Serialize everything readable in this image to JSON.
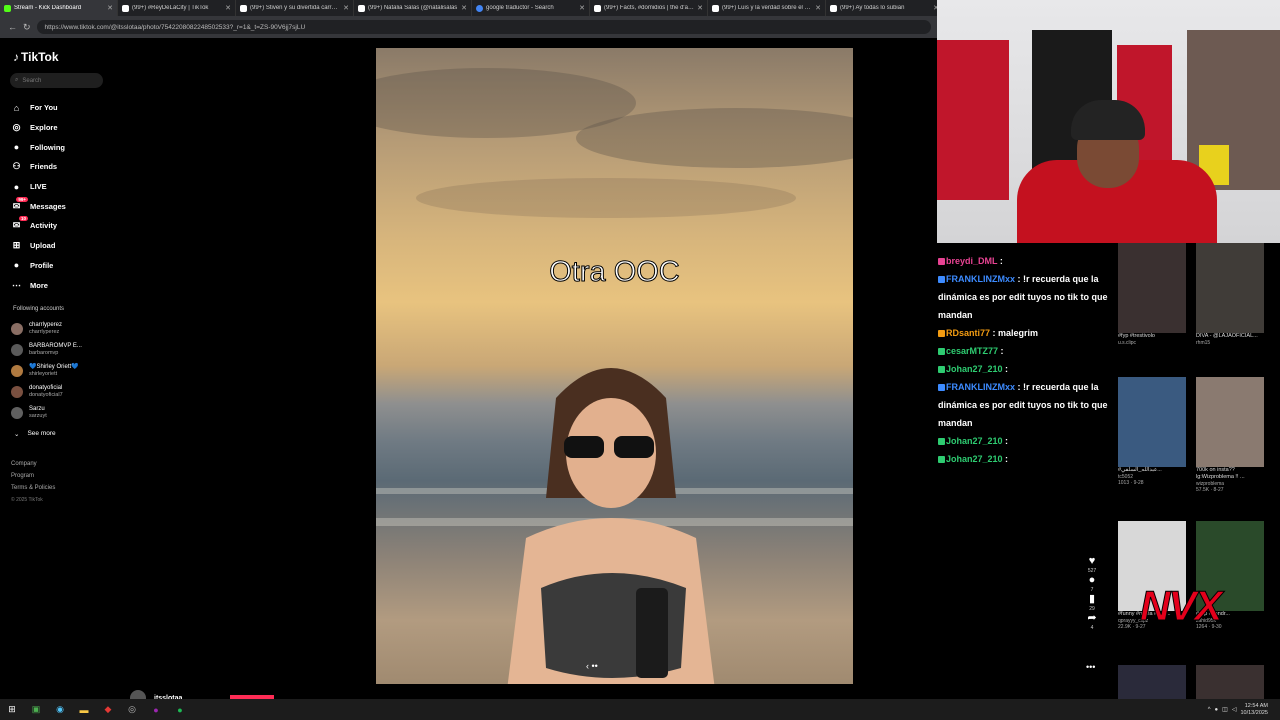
{
  "tabs": [
    {
      "label": "Stream - Kick Dashboard",
      "fav": "kick"
    },
    {
      "label": "(99+) #ReyDeLaCity | TikTok",
      "fav": "tiktok"
    },
    {
      "label": "(99+) Stiven y su divertida carrera",
      "fav": "tiktok"
    },
    {
      "label": "(99+) Natalia Salas (@natalisalas",
      "fav": "tiktok"
    },
    {
      "label": "google traductor - Search",
      "fav": "g"
    },
    {
      "label": "(99+) Facts, #domidios | the d'arm",
      "fav": "tiktok"
    },
    {
      "label": "(99+) Luis y la verdad sobre el car",
      "fav": "tiktok"
    },
    {
      "label": "(99+) Ay todas lo subian",
      "fav": "tiktok"
    }
  ],
  "browser": {
    "url": "https://www.tiktok.com/@itsslotaa/photo/7542208082248502533?_r=1&_t=ZS-90V6jj7sjLU"
  },
  "sidebar": {
    "brand": "TikTok",
    "search_placeholder": "Search",
    "nav": [
      {
        "label": "For You",
        "icon": "home-icon"
      },
      {
        "label": "Explore",
        "icon": "compass-icon"
      },
      {
        "label": "Following",
        "icon": "following-icon"
      },
      {
        "label": "Friends",
        "icon": "friends-icon"
      },
      {
        "label": "LIVE",
        "icon": "live-icon"
      },
      {
        "label": "Messages",
        "icon": "messages-icon",
        "badge": "99+"
      },
      {
        "label": "Activity",
        "icon": "activity-icon",
        "badge": "10"
      },
      {
        "label": "Upload",
        "icon": "upload-icon"
      },
      {
        "label": "Profile",
        "icon": "profile-icon"
      },
      {
        "label": "More",
        "icon": "more-icon"
      }
    ],
    "following_title": "Following accounts",
    "accounts": [
      {
        "name": "charrlyperez",
        "handle": "charrlyperez"
      },
      {
        "name": "BARBAROMVP E...",
        "handle": "barbaromvp"
      },
      {
        "name": "💙Shirley Oriett💙",
        "handle": "shirleyoriett"
      },
      {
        "name": "donatyoficial",
        "handle": "donatyoficial7"
      },
      {
        "name": "Sarzu",
        "handle": "sarzuyt"
      }
    ],
    "see_more": "See more",
    "footer": [
      "Company",
      "Program",
      "Terms & Policies"
    ],
    "copyright": "© 2025 TikTok"
  },
  "post": {
    "caption": "Otra OOC",
    "author": "itsslotaa"
  },
  "chat": [
    {
      "user": "breydi_DML",
      "color": "#e84393",
      "text": ""
    },
    {
      "user": "FRANKLINZMxx",
      "color": "#3d8bff",
      "text": "!r recuerda que la dinámica es por edit tuyos no tik to que mandan"
    },
    {
      "user": "RDsanti77",
      "color": "#f39c12",
      "text": "malegrim"
    },
    {
      "user": "cesarMTZ77",
      "color": "#2ecc71",
      "text": ""
    },
    {
      "user": "Johan27_210",
      "color": "#2ecc71",
      "text": ""
    },
    {
      "user": "FRANKLINZMxx",
      "color": "#3d8bff",
      "text": "!r recuerda que la dinámica es por edit tuyos no tik to que mandan"
    },
    {
      "user": "Johan27_210",
      "color": "#2ecc71",
      "text": ""
    },
    {
      "user": "Johan27_210",
      "color": "#2ecc71",
      "text": ""
    }
  ],
  "recs": [
    {
      "caption": "#fyp #trestivolo",
      "author": "u.s.clipc",
      "stats": ""
    },
    {
      "caption": "DIVA - @LAJAOFICIAL...",
      "author": "rhm15",
      "stats": ""
    },
    {
      "caption": "#عبدالله_السلفي...",
      "author": "tc5052",
      "stats": "1013 · 9-28"
    },
    {
      "caption": "700k on insta?? lg:Wizproblema !! ...",
      "author": "wizproblema",
      "stats": "57.5K · 8-27"
    },
    {
      "caption": "#funny #mafia #fyp ...",
      "author": "qprayyy_clipz",
      "stats": "22.9K · 9-27"
    },
    {
      "caption": "#clip #sandr...",
      "author": "zahid95k",
      "stats": "1264 · 9-30"
    }
  ],
  "actions": [
    {
      "icon": "heart-icon",
      "count": "527"
    },
    {
      "icon": "comment-icon",
      "count": "7"
    },
    {
      "icon": "bookmark-icon",
      "count": "29"
    },
    {
      "icon": "share-icon",
      "count": "4"
    }
  ],
  "overlay": {
    "logo": "NVX"
  },
  "taskbar": {
    "time": "12:54 AM",
    "date": "10/13/2025"
  }
}
